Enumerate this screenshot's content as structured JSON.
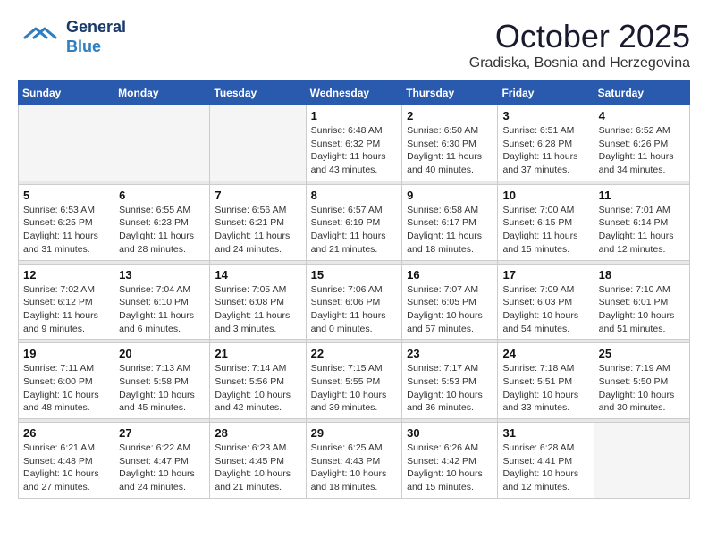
{
  "header": {
    "logo_general": "General",
    "logo_blue": "Blue",
    "title": "October 2025",
    "subtitle": "Gradiska, Bosnia and Herzegovina"
  },
  "days_of_week": [
    "Sunday",
    "Monday",
    "Tuesday",
    "Wednesday",
    "Thursday",
    "Friday",
    "Saturday"
  ],
  "weeks": [
    {
      "days": [
        {
          "num": "",
          "info": "",
          "empty": true
        },
        {
          "num": "",
          "info": "",
          "empty": true
        },
        {
          "num": "",
          "info": "",
          "empty": true
        },
        {
          "num": "1",
          "info": "Sunrise: 6:48 AM\nSunset: 6:32 PM\nDaylight: 11 hours\nand 43 minutes.",
          "empty": false
        },
        {
          "num": "2",
          "info": "Sunrise: 6:50 AM\nSunset: 6:30 PM\nDaylight: 11 hours\nand 40 minutes.",
          "empty": false
        },
        {
          "num": "3",
          "info": "Sunrise: 6:51 AM\nSunset: 6:28 PM\nDaylight: 11 hours\nand 37 minutes.",
          "empty": false
        },
        {
          "num": "4",
          "info": "Sunrise: 6:52 AM\nSunset: 6:26 PM\nDaylight: 11 hours\nand 34 minutes.",
          "empty": false
        }
      ]
    },
    {
      "days": [
        {
          "num": "5",
          "info": "Sunrise: 6:53 AM\nSunset: 6:25 PM\nDaylight: 11 hours\nand 31 minutes.",
          "empty": false
        },
        {
          "num": "6",
          "info": "Sunrise: 6:55 AM\nSunset: 6:23 PM\nDaylight: 11 hours\nand 28 minutes.",
          "empty": false
        },
        {
          "num": "7",
          "info": "Sunrise: 6:56 AM\nSunset: 6:21 PM\nDaylight: 11 hours\nand 24 minutes.",
          "empty": false
        },
        {
          "num": "8",
          "info": "Sunrise: 6:57 AM\nSunset: 6:19 PM\nDaylight: 11 hours\nand 21 minutes.",
          "empty": false
        },
        {
          "num": "9",
          "info": "Sunrise: 6:58 AM\nSunset: 6:17 PM\nDaylight: 11 hours\nand 18 minutes.",
          "empty": false
        },
        {
          "num": "10",
          "info": "Sunrise: 7:00 AM\nSunset: 6:15 PM\nDaylight: 11 hours\nand 15 minutes.",
          "empty": false
        },
        {
          "num": "11",
          "info": "Sunrise: 7:01 AM\nSunset: 6:14 PM\nDaylight: 11 hours\nand 12 minutes.",
          "empty": false
        }
      ]
    },
    {
      "days": [
        {
          "num": "12",
          "info": "Sunrise: 7:02 AM\nSunset: 6:12 PM\nDaylight: 11 hours\nand 9 minutes.",
          "empty": false
        },
        {
          "num": "13",
          "info": "Sunrise: 7:04 AM\nSunset: 6:10 PM\nDaylight: 11 hours\nand 6 minutes.",
          "empty": false
        },
        {
          "num": "14",
          "info": "Sunrise: 7:05 AM\nSunset: 6:08 PM\nDaylight: 11 hours\nand 3 minutes.",
          "empty": false
        },
        {
          "num": "15",
          "info": "Sunrise: 7:06 AM\nSunset: 6:06 PM\nDaylight: 11 hours\nand 0 minutes.",
          "empty": false
        },
        {
          "num": "16",
          "info": "Sunrise: 7:07 AM\nSunset: 6:05 PM\nDaylight: 10 hours\nand 57 minutes.",
          "empty": false
        },
        {
          "num": "17",
          "info": "Sunrise: 7:09 AM\nSunset: 6:03 PM\nDaylight: 10 hours\nand 54 minutes.",
          "empty": false
        },
        {
          "num": "18",
          "info": "Sunrise: 7:10 AM\nSunset: 6:01 PM\nDaylight: 10 hours\nand 51 minutes.",
          "empty": false
        }
      ]
    },
    {
      "days": [
        {
          "num": "19",
          "info": "Sunrise: 7:11 AM\nSunset: 6:00 PM\nDaylight: 10 hours\nand 48 minutes.",
          "empty": false
        },
        {
          "num": "20",
          "info": "Sunrise: 7:13 AM\nSunset: 5:58 PM\nDaylight: 10 hours\nand 45 minutes.",
          "empty": false
        },
        {
          "num": "21",
          "info": "Sunrise: 7:14 AM\nSunset: 5:56 PM\nDaylight: 10 hours\nand 42 minutes.",
          "empty": false
        },
        {
          "num": "22",
          "info": "Sunrise: 7:15 AM\nSunset: 5:55 PM\nDaylight: 10 hours\nand 39 minutes.",
          "empty": false
        },
        {
          "num": "23",
          "info": "Sunrise: 7:17 AM\nSunset: 5:53 PM\nDaylight: 10 hours\nand 36 minutes.",
          "empty": false
        },
        {
          "num": "24",
          "info": "Sunrise: 7:18 AM\nSunset: 5:51 PM\nDaylight: 10 hours\nand 33 minutes.",
          "empty": false
        },
        {
          "num": "25",
          "info": "Sunrise: 7:19 AM\nSunset: 5:50 PM\nDaylight: 10 hours\nand 30 minutes.",
          "empty": false
        }
      ]
    },
    {
      "days": [
        {
          "num": "26",
          "info": "Sunrise: 6:21 AM\nSunset: 4:48 PM\nDaylight: 10 hours\nand 27 minutes.",
          "empty": false
        },
        {
          "num": "27",
          "info": "Sunrise: 6:22 AM\nSunset: 4:47 PM\nDaylight: 10 hours\nand 24 minutes.",
          "empty": false
        },
        {
          "num": "28",
          "info": "Sunrise: 6:23 AM\nSunset: 4:45 PM\nDaylight: 10 hours\nand 21 minutes.",
          "empty": false
        },
        {
          "num": "29",
          "info": "Sunrise: 6:25 AM\nSunset: 4:43 PM\nDaylight: 10 hours\nand 18 minutes.",
          "empty": false
        },
        {
          "num": "30",
          "info": "Sunrise: 6:26 AM\nSunset: 4:42 PM\nDaylight: 10 hours\nand 15 minutes.",
          "empty": false
        },
        {
          "num": "31",
          "info": "Sunrise: 6:28 AM\nSunset: 4:41 PM\nDaylight: 10 hours\nand 12 minutes.",
          "empty": false
        },
        {
          "num": "",
          "info": "",
          "empty": true
        }
      ]
    }
  ]
}
